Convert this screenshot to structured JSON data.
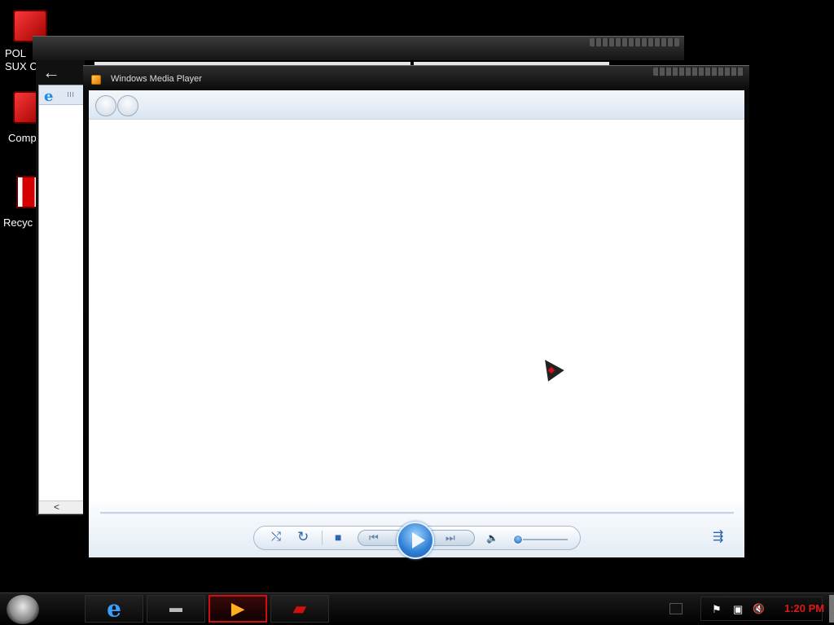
{
  "desktop": {
    "icons": [
      {
        "label": "POL\nSUX C",
        "icon": "folder-icon"
      },
      {
        "label": "Comp",
        "icon": "computer-icon"
      },
      {
        "label": "Recyc",
        "icon": "recycle-bin-icon"
      }
    ]
  },
  "ie_window": {
    "back_icon": "back-arrow-icon",
    "tab_icon": "internet-explorer-icon",
    "tab_text": "ııı",
    "scroll_label": "<"
  },
  "wmp": {
    "title": "Windows Media Player",
    "title_icon": "media-player-icon",
    "nav": {
      "back": "back-icon",
      "forward": "forward-icon"
    },
    "controls": {
      "shuffle": "⤭",
      "repeat": "↻",
      "stop": "■",
      "previous": "⏮",
      "play": "play-icon",
      "next": "⏭",
      "mute": "🔈",
      "switch_view": "⇶"
    },
    "volume_level": 0.05
  },
  "taskbar": {
    "start": "start-orb-icon",
    "buttons": [
      {
        "name": "internet-explorer",
        "glyph": "e",
        "active": false
      },
      {
        "name": "file-explorer",
        "glyph": "▬",
        "active": false
      },
      {
        "name": "windows-media-player",
        "glyph": "▶",
        "active": true
      },
      {
        "name": "alienware-app",
        "glyph": "▰",
        "active": false
      }
    ],
    "tray": {
      "flag": "⚑",
      "network": "▣",
      "volume": "🔇",
      "clock": "1:20 PM"
    }
  },
  "colors": {
    "accent_red": "#d01010",
    "wmp_blue": "#2f7fd6",
    "clock_red": "#e01818"
  }
}
